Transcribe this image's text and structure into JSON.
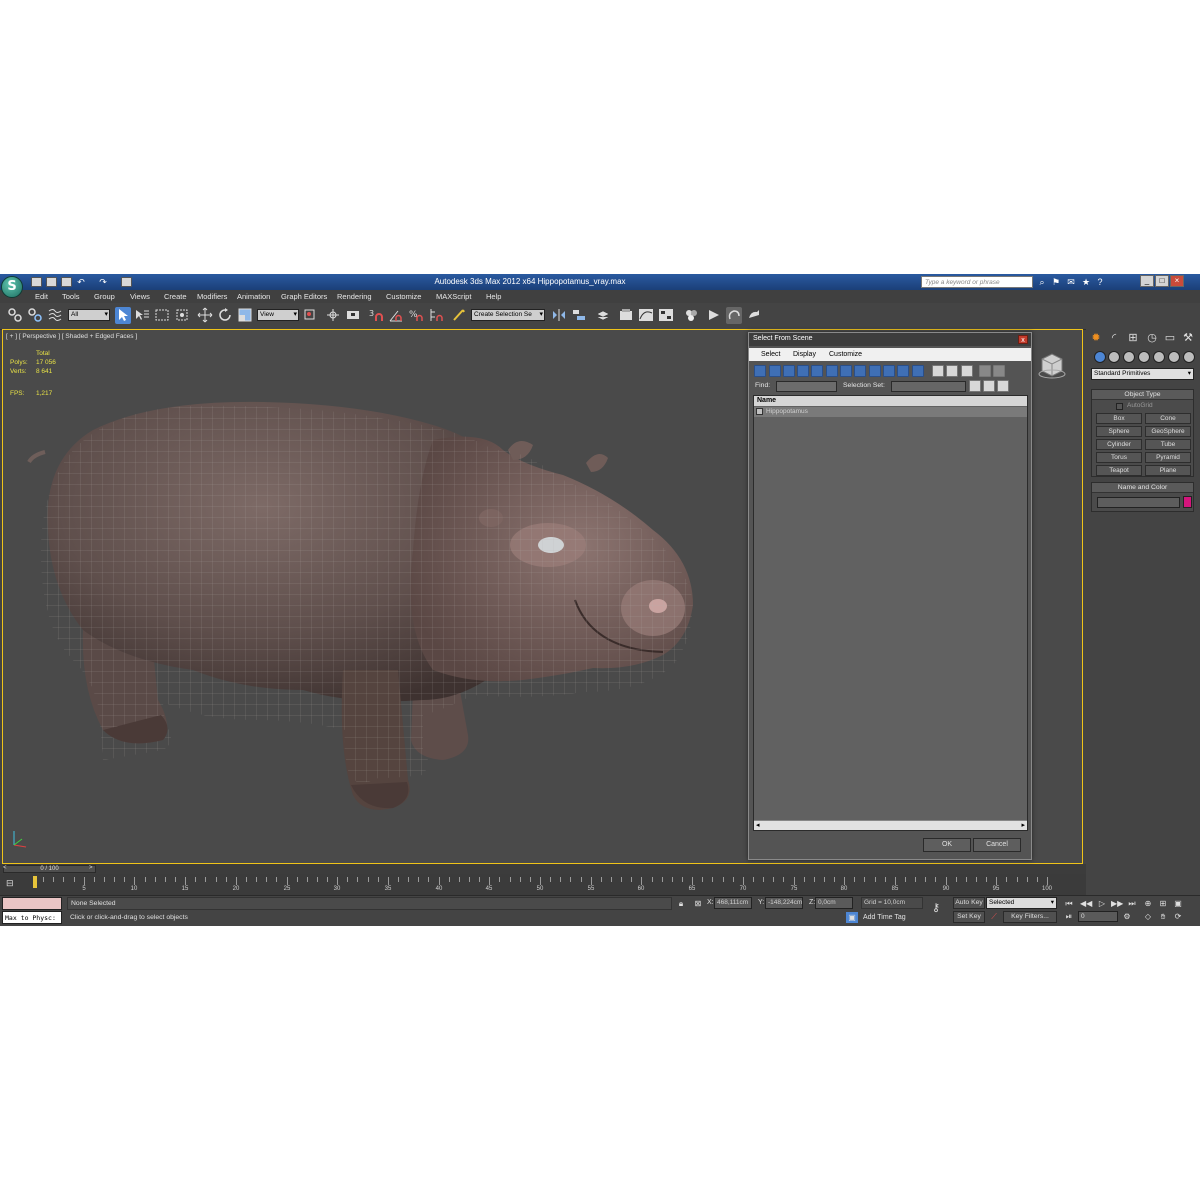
{
  "window": {
    "title": "Autodesk 3ds Max  2012 x64      Hippopotamus_vray.max",
    "search_placeholder": "Type a keyword or phrase"
  },
  "menu": [
    "Edit",
    "Tools",
    "Group",
    "Views",
    "Create",
    "Modifiers",
    "Animation",
    "Graph Editors",
    "Rendering",
    "Customize",
    "MAXScript",
    "Help"
  ],
  "toolbar": {
    "selection_filter": "All",
    "reference_coord": "View",
    "named_selection_placeholder": "Create Selection Se"
  },
  "viewport": {
    "label": "[ + ] [ Perspective ] [ Shaded + Edged Faces ]",
    "stats": {
      "header": "Total",
      "polys_label": "Polys:",
      "polys_value": "17 056",
      "verts_label": "Verts:",
      "verts_value": "8 641",
      "fps_label": "FPS:",
      "fps_value": "1,217"
    }
  },
  "dialog": {
    "title": "Select From Scene",
    "close_glyph": "x",
    "menu": [
      "Select",
      "Display",
      "Customize"
    ],
    "find_label": "Find:",
    "selection_set_label": "Selection Set:",
    "column_name": "Name",
    "rows": [
      "Hippopotamus"
    ],
    "ok_label": "OK",
    "cancel_label": "Cancel"
  },
  "command_panel": {
    "category": "Standard Primitives",
    "object_type_title": "Object Type",
    "autogrid_label": "AutoGrid",
    "primitives": [
      "Box",
      "Cone",
      "Sphere",
      "GeoSphere",
      "Cylinder",
      "Tube",
      "Torus",
      "Pyramid",
      "Teapot",
      "Plane"
    ],
    "name_color_title": "Name and Color",
    "object_color": "#d4157c"
  },
  "timeline": {
    "slider_label": "0 / 100",
    "current_frame": 0,
    "frame_count": 100,
    "ticks": [
      "5",
      "10",
      "15",
      "20",
      "25",
      "30",
      "35",
      "40",
      "45",
      "50",
      "55",
      "60",
      "65",
      "70",
      "75",
      "80",
      "85",
      "90",
      "95",
      "100"
    ]
  },
  "status": {
    "maxscript_listener": "Max to Physc:",
    "selection": "None Selected",
    "prompt": "Click or click-and-drag to select objects",
    "x_label": "X:",
    "x_value": "468,111cm",
    "y_label": "Y:",
    "y_value": "-148,224cm",
    "z_label": "Z:",
    "z_value": "0,0cm",
    "grid": "Grid = 10,0cm",
    "add_time_tag": "Add Time Tag",
    "auto_key": "Auto Key",
    "set_key": "Set Key",
    "key_mode": "Selected",
    "key_filters": "Key Filters...",
    "frame_value": "0"
  }
}
